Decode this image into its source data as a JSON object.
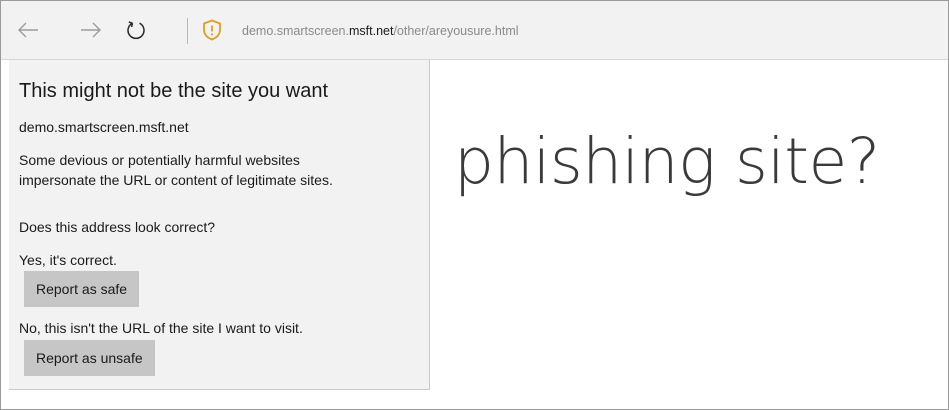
{
  "browser": {
    "address": {
      "prefix": "demo.smartscreen.",
      "host_strong": "msft.net",
      "path": "/other/areyousure.html"
    },
    "icons": {
      "back": "arrow-left-icon",
      "forward": "arrow-right-icon",
      "refresh": "refresh-icon",
      "site_info": "shield-warning-icon"
    },
    "colors": {
      "shield_warning": "#e0a020",
      "toolbar_background": "#f2f2f2",
      "flyout_background": "#f2f2f2",
      "button_background": "#c6c6c6"
    }
  },
  "flyout": {
    "title": "This might not be the site you want",
    "domain": "demo.smartscreen.msft.net",
    "description_line1": "Some devious or potentially harmful websites",
    "description_line2": "impersonate the URL or content of legitimate sites.",
    "question": "Does this address look correct?",
    "yes_text": "Yes, it's correct.",
    "report_safe_label": "Report as safe",
    "no_text": "No, this isn't the URL of the site I want to visit.",
    "report_unsafe_label": "Report as unsafe"
  },
  "page": {
    "headline": "phishing site?"
  }
}
